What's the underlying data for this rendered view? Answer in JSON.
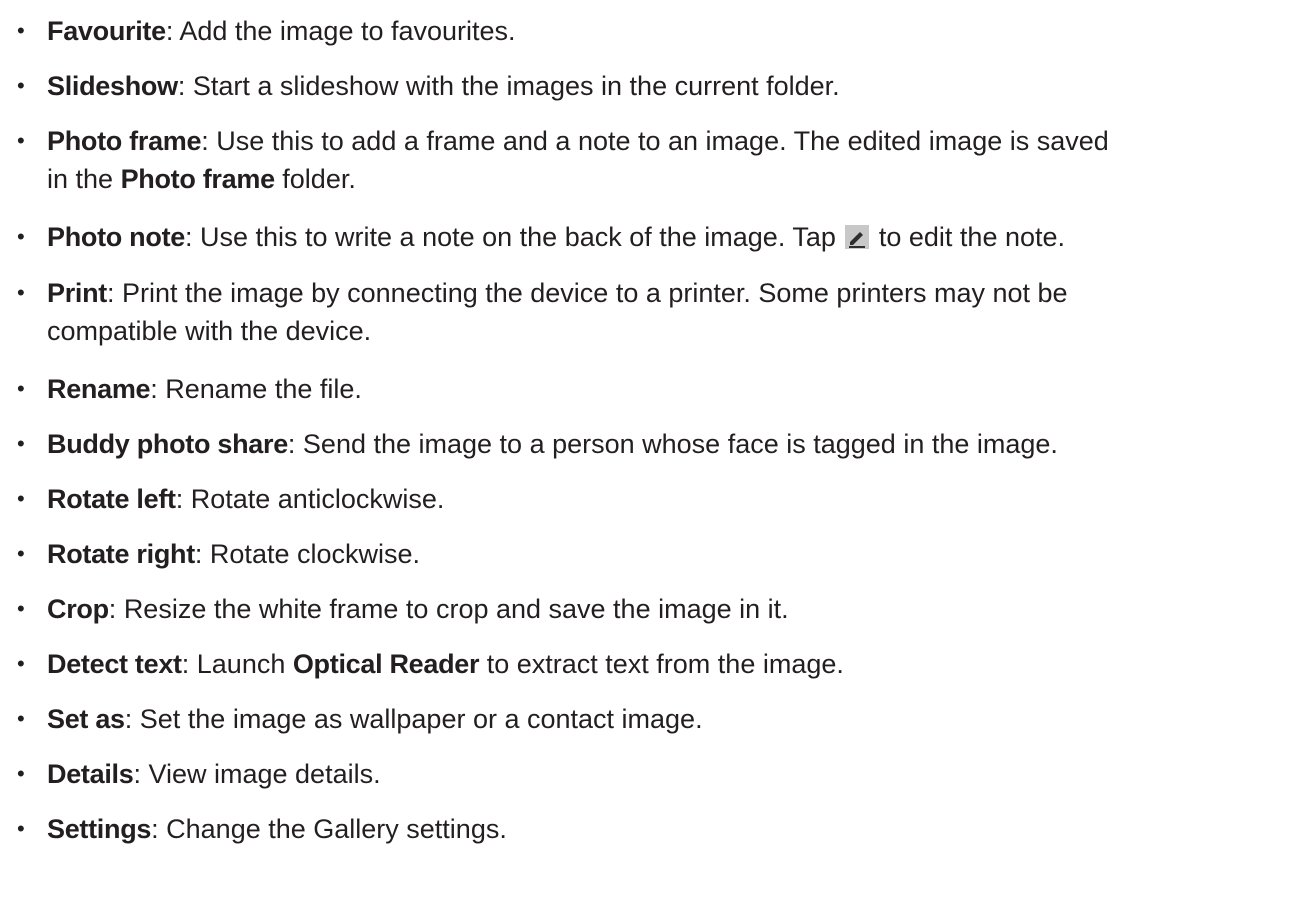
{
  "items": [
    {
      "term": "Favourite",
      "sep": ": ",
      "desc": "Add the image to favourites."
    },
    {
      "term": "Slideshow",
      "sep": ": ",
      "desc": "Start a slideshow with the images in the current folder."
    },
    {
      "term": "Photo frame",
      "sep": ": ",
      "desc": "Use this to add a frame and a note to an image. The edited image is saved",
      "line2_pre": "in the ",
      "line2_bold": "Photo frame",
      "line2_post": " folder."
    },
    {
      "term": "Photo note",
      "sep": ": ",
      "desc": "Use this to write a note on the back of the image. Tap ",
      "icon": "edit-icon",
      "desc_after": " to edit the note."
    },
    {
      "term": "Print",
      "sep": ": ",
      "desc": "Print the image by connecting the device to a printer. Some printers may not be",
      "line2": "compatible with the device."
    },
    {
      "term": "Rename",
      "sep": ": ",
      "desc": "Rename the file."
    },
    {
      "term": "Buddy photo share",
      "sep": ": ",
      "desc": "Send the image to a person whose face is tagged in the image."
    },
    {
      "term": "Rotate left",
      "sep": ": ",
      "desc": "Rotate anticlockwise."
    },
    {
      "term": "Rotate right",
      "sep": ": ",
      "desc": "Rotate clockwise."
    },
    {
      "term": "Crop",
      "sep": ": ",
      "desc": "Resize the white frame to crop and save the image in it."
    },
    {
      "term": "Detect text",
      "sep": ": ",
      "desc": "Launch ",
      "desc_bold": "Optical Reader",
      "desc_after": " to extract text from the image."
    },
    {
      "term": "Set as",
      "sep": ": ",
      "desc": "Set the image as wallpaper or a contact image."
    },
    {
      "term": "Details",
      "sep": ": ",
      "desc": "View image details."
    },
    {
      "term": "Settings",
      "sep": ": ",
      "desc": "Change the Gallery settings."
    }
  ],
  "bullet_char": "•",
  "icon_colors": {
    "edit_icon_bg": "#c8c8c8",
    "edit_icon_fg": "#2e2e2e"
  }
}
